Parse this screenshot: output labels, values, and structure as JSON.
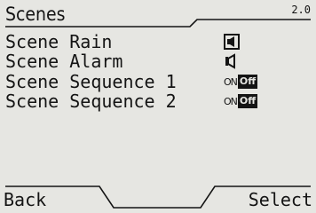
{
  "header": {
    "title": "Scenes",
    "version": "2.0"
  },
  "scenes": [
    {
      "label": "Scene Rain",
      "control": "icon",
      "icon": "speaker-box-icon"
    },
    {
      "label": "Scene Alarm",
      "control": "icon",
      "icon": "speaker-icon"
    },
    {
      "label": "Scene Sequence 1",
      "control": "toggle",
      "on_label": "ON",
      "off_label": "Off",
      "value": "Off"
    },
    {
      "label": "Scene Sequence 2",
      "control": "toggle",
      "on_label": "ON",
      "off_label": "Off",
      "value": "Off"
    }
  ],
  "softkeys": {
    "left": "Back",
    "right": "Select"
  },
  "colors": {
    "background": "#e6e6e2",
    "foreground": "#141414"
  }
}
